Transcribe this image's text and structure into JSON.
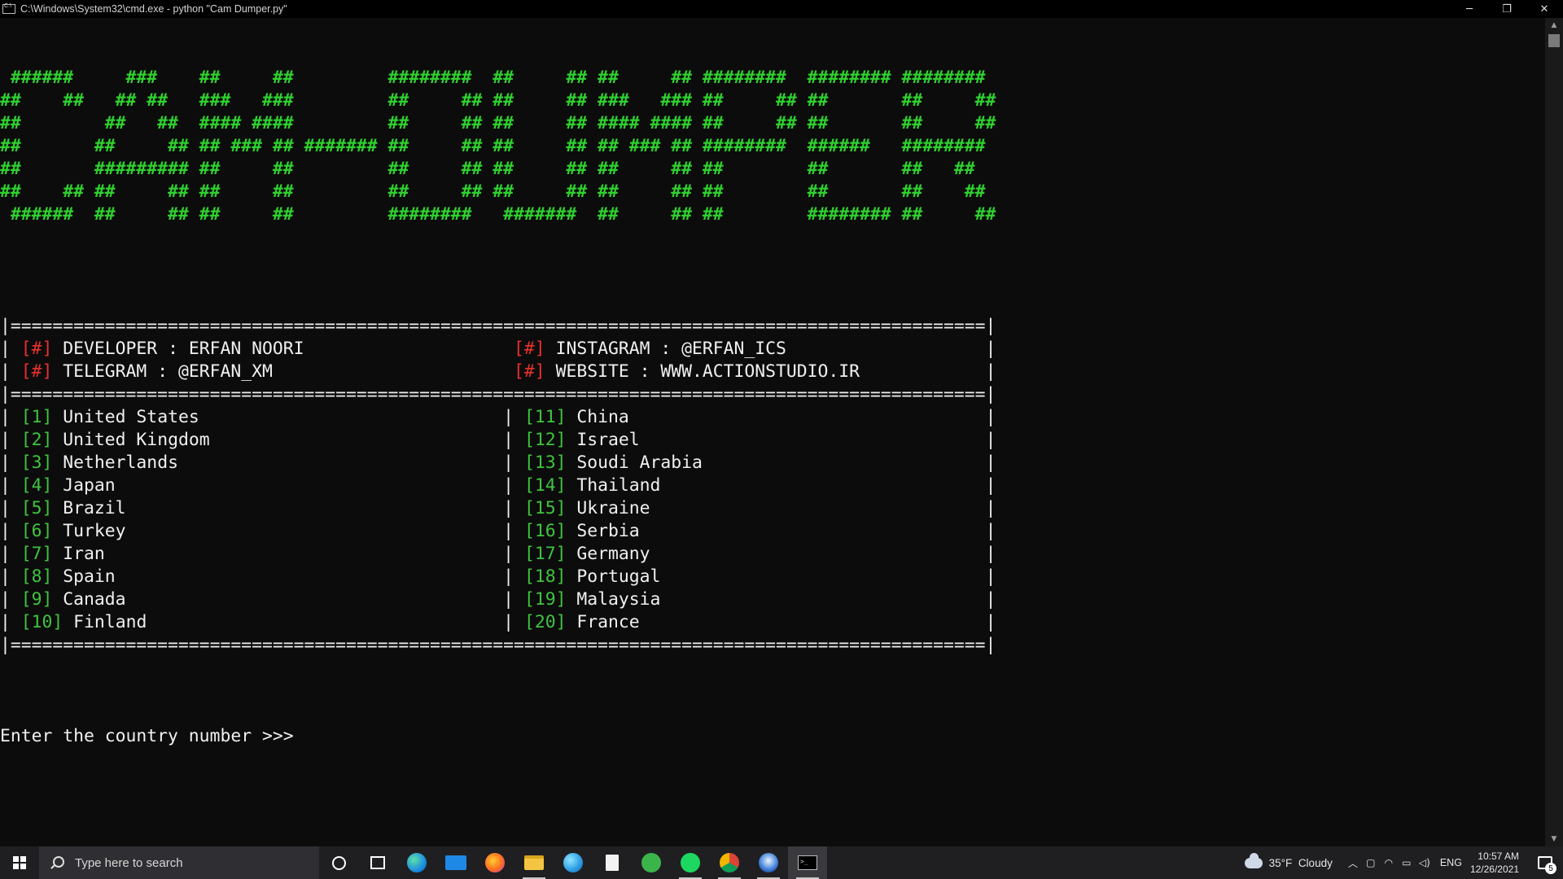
{
  "window": {
    "title": "C:\\Windows\\System32\\cmd.exe - python  \"Cam Dumper.py\"",
    "minimize": "─",
    "restore": "❐",
    "close": "✕"
  },
  "console": {
    "banner": [
      " ######     ###    ##     ##         ########  ##     ## ##     ## ########  ######## ########",
      "##    ##   ## ##   ###   ###         ##     ## ##     ## ###   ### ##     ## ##       ##     ##",
      "##        ##   ##  #### ####         ##     ## ##     ## #### #### ##     ## ##       ##     ##",
      "##       ##     ## ## ### ## ####### ##     ## ##     ## ## ### ## ########  ######   ########",
      "##       ######### ##     ##         ##     ## ##     ## ##     ## ##        ##       ##   ##",
      "##    ## ##     ## ##     ##         ##     ## ##     ## ##     ## ##        ##       ##    ##",
      " ######  ##     ## ##     ##         ########   #######  ##     ## ##        ######## ##     ##"
    ],
    "separator": "|=============================================================================================|",
    "info": [
      {
        "left_tag": "[#]",
        "left_text": "DEVELOPER : ERFAN NOORI",
        "right_tag": "[#]",
        "right_text": "INSTAGRAM : @ERFAN_ICS"
      },
      {
        "left_tag": "[#]",
        "left_text": "TELEGRAM : @ERFAN_XM",
        "right_tag": "[#]",
        "right_text": "WEBSITE : WWW.ACTIONSTUDIO.IR"
      }
    ],
    "countries": [
      {
        "ln": "[1]",
        "lc": "United States",
        "rn": "[11]",
        "rc": "China"
      },
      {
        "ln": "[2]",
        "lc": "United Kingdom",
        "rn": "[12]",
        "rc": "Israel"
      },
      {
        "ln": "[3]",
        "lc": "Netherlands",
        "rn": "[13]",
        "rc": "Soudi Arabia"
      },
      {
        "ln": "[4]",
        "lc": "Japan",
        "rn": "[14]",
        "rc": "Thailand"
      },
      {
        "ln": "[5]",
        "lc": "Brazil",
        "rn": "[15]",
        "rc": "Ukraine"
      },
      {
        "ln": "[6]",
        "lc": "Turkey",
        "rn": "[16]",
        "rc": "Serbia"
      },
      {
        "ln": "[7]",
        "lc": "Iran",
        "rn": "[17]",
        "rc": "Germany"
      },
      {
        "ln": "[8]",
        "lc": "Spain",
        "rn": "[18]",
        "rc": "Portugal"
      },
      {
        "ln": "[9]",
        "lc": "Canada",
        "rn": "[19]",
        "rc": "Malaysia"
      },
      {
        "ln": "[10]",
        "lc": "Finland",
        "rn": "[20]",
        "rc": "France"
      }
    ],
    "prompt": "Enter the country number >>> "
  },
  "taskbar": {
    "search_placeholder": "Type here to search",
    "weather_temp": "35°F",
    "weather_desc": "Cloudy",
    "language": "ENG",
    "time": "10:57 AM",
    "date": "12/26/2021",
    "notification_count": "5"
  },
  "colors": {
    "banner": "#2fd12f",
    "tag_red": "#e8312e",
    "number_green": "#3fc43f",
    "console_bg": "#0c0c0c",
    "text": "#f0f0f0"
  }
}
